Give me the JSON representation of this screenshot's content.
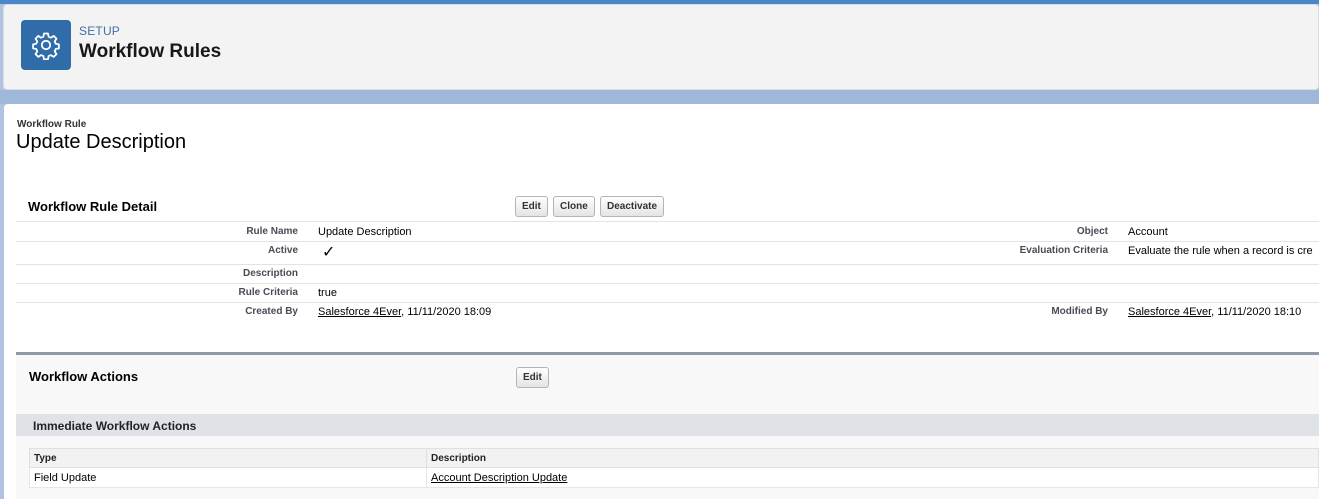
{
  "header": {
    "eyebrow": "SETUP",
    "title": "Workflow Rules",
    "icon": "gear-icon"
  },
  "record": {
    "eyebrow": "Workflow Rule",
    "title": "Update Description"
  },
  "detail": {
    "section_title": "Workflow Rule Detail",
    "buttons": {
      "edit": "Edit",
      "clone": "Clone",
      "deactivate": "Deactivate"
    },
    "fields": {
      "rule_name_label": "Rule Name",
      "rule_name_value": "Update Description",
      "active_label": "Active",
      "active_value": "✓",
      "description_label": "Description",
      "description_value": "",
      "rule_criteria_label": "Rule Criteria",
      "rule_criteria_value": "true",
      "created_by_label": "Created By",
      "created_by_user": "Salesforce 4Ever",
      "created_by_date": ", 11/11/2020 18:09",
      "object_label": "Object",
      "object_value": "Account",
      "evaluation_label": "Evaluation Criteria",
      "evaluation_value": "Evaluate the rule when a record is cre",
      "modified_by_label": "Modified By",
      "modified_by_user": "Salesforce 4Ever",
      "modified_by_date": ", 11/11/2020 18:10"
    }
  },
  "actions": {
    "section_title": "Workflow Actions",
    "edit_label": "Edit",
    "immediate_title": "Immediate Workflow Actions",
    "columns": [
      "Type",
      "Description"
    ],
    "rows": [
      {
        "type": "Field Update",
        "description": "Account Description Update"
      }
    ]
  },
  "colors": {
    "accent": "#2f6ca8",
    "band": "#9fb8d9",
    "header_bg": "#f3f3f3"
  }
}
